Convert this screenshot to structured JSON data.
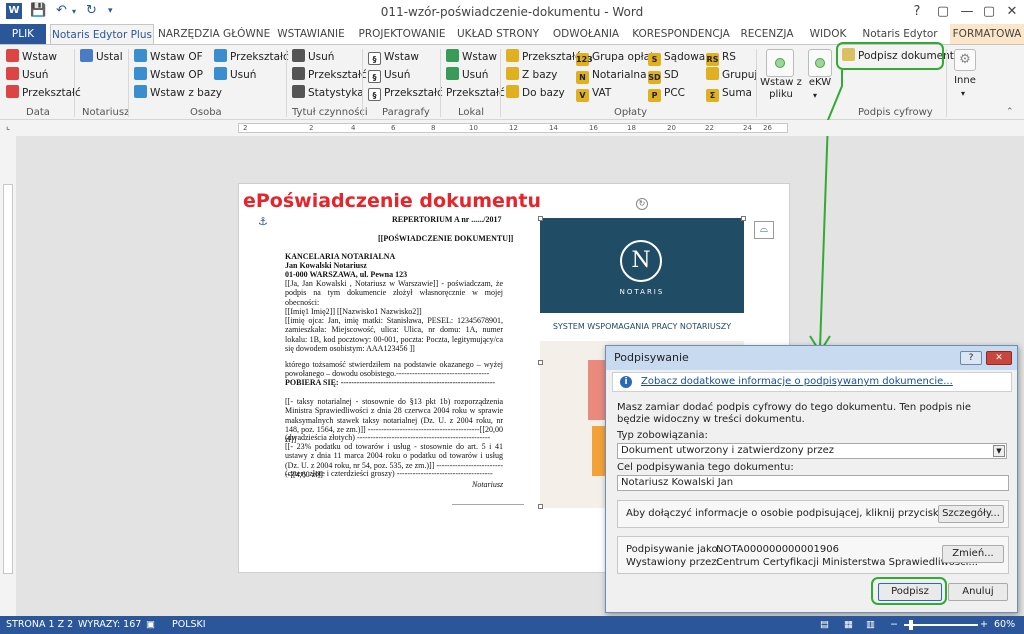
{
  "window": {
    "title": "011-wzór-poświadczenie-dokumentu - Word",
    "controls": [
      "?",
      "▢",
      "—",
      "▢",
      "✕"
    ]
  },
  "tabs": [
    "PLIK",
    "Notaris Edytor Plus",
    "NARZĘDZIA GŁÓWNE",
    "WSTAWIANIE",
    "PROJEKTOWANIE",
    "UKŁAD STRONY",
    "ODWOŁANIA",
    "KORESPONDENCJA",
    "RECENZJA",
    "WIDOK",
    "Notaris Edytor",
    "FORMATOWA"
  ],
  "ribbon": {
    "data": {
      "items": [
        "Wstaw",
        "Usuń",
        "Przekształć"
      ],
      "label": "Data"
    },
    "notariusz": {
      "items": [
        "Ustal"
      ],
      "label": "Notariusz"
    },
    "osoba": {
      "col1": [
        "Wstaw OF",
        "Wstaw OP",
        "Wstaw z bazy"
      ],
      "col2": [
        "Przekształć",
        "Usuń"
      ],
      "label": "Osoba"
    },
    "tytul": {
      "items": [
        "Usuń",
        "Przekształć",
        "Statystyka"
      ],
      "label": "Tytuł czynności"
    },
    "paragrafy": {
      "items": [
        "Wstaw",
        "Usuń",
        "Przekształć"
      ],
      "label": "Paragrafy"
    },
    "lokal": {
      "items": [
        "Wstaw",
        "Usuń",
        "Przekształć"
      ],
      "label": "Lokal"
    },
    "oplaty": {
      "col1": [
        "Przekształć",
        "Z bazy",
        "Do bazy"
      ],
      "col2": [
        "Grupa opłat",
        "Notarialna",
        "VAT"
      ],
      "col3": [
        "Sądowa",
        "SD",
        "PCC"
      ],
      "col4": [
        "RS",
        "Grupuj",
        "Suma"
      ],
      "label": "Opłaty"
    },
    "podpis": {
      "wstaw": "Wstaw z pliku",
      "ekw": "eKW",
      "podpisz": "Podpisz dokument",
      "label": "Podpis cyfrowy"
    },
    "inne": {
      "label": "Inne"
    }
  },
  "ruler": [
    "2",
    "2",
    "4",
    "6",
    "8",
    "10",
    "12",
    "14",
    "16",
    "18",
    "20",
    "22",
    "24",
    "26"
  ],
  "document": {
    "title": "ePoświadczenie dokumentu",
    "repertorium": "REPERTORIUM A nr ....../2017",
    "heading": "[[POŚWIADCZENIE DOKUMENTU]]",
    "kancelaria": "KANCELARIA NOTARIALNA",
    "notary": "Jan Kowalski Notariusz",
    "address": "01-000 WARSZAWA, ul. Pewna 123",
    "para1": "[[Ja, Jan Kowalski , Notariusz w Warszawie]] - poświadczam, że podpis na tym dokumencie złożył własnoręcznie w mojej obecności:",
    "para2": "[[Imię1 Imię2]] [[Nazwisko1 Nazwisko2]]",
    "para3": "[[imię ojca: Jan, imię matki: Stanisława, PESEL: 12345678901, zamieszkała: Miejscowość, ulica: Ulica, nr domu: 1A, numer lokalu: 1B, kod pocztowy: 00-001, poczta: Poczta, legitymujący/ca się dowodem osobistym: AAA123456 ]]",
    "para4": "którego tożsamość stwierdziłem na podstawie okazanego – wyżej powołanego – dowodu osobistego.-----------------------------------",
    "pobiera": "POBIERA SIĘ: ----------------------------------------------------------",
    "para5": "[[- taksy notarialnej - stosownie do §13 pkt 1b) rozporządzenia Ministra Sprawiedliwości z dnia 28 czerwca 2004 roku w sprawie maksymalnych stawek taksy notarialnej (Dz. U. z 2004 roku, nr 148, poz. 1564, ze zm.)]] ------------------------------------------[[20,00 zł]]",
    "para6": "(dwadzieścia złotych) --------------------------------------------------",
    "para7": "[[- 23% podatku od towarów i usług - stosownie do art. 5 i 41 ustawy z dnia 11 marca 2004 roku o podatku od towarów i usług (Dz. U. z 2004 roku, nr 54, poz. 535, ze zm.)]] ---------------------------[[4,60 zł]]",
    "para8": "(cztery złote i czterdzieści groszy) ------------------------------------",
    "signature": "Notariusz",
    "signline": "...................................."
  },
  "image": {
    "logo_letter": "N",
    "brand": "NOTARIS",
    "subtitle": "SYSTEM WSPOMAGANIA PRACY NOTARIUSZY"
  },
  "dialog": {
    "title": "Podpisywanie",
    "info_link": "Zobacz dodatkowe informacje o podpisywanym dokumencie...",
    "question": "Masz zamiar dodać podpis cyfrowy do tego dokumentu. Ten podpis nie będzie widoczny w treści dokumentu.",
    "type_label": "Typ zobowiązania:",
    "type_value": "Dokument utworzony i zatwierdzony przez",
    "purpose_label": "Cel podpisywania tego dokumentu:",
    "purpose_value": "Notariusz Kowalski Jan",
    "details_text": "Aby dołączyć informacje o osobie podpisującej, kliknij przycisk Szczegóły.",
    "details_button": "Szczegóły...",
    "signing_as_label": "Podpisywanie jako:",
    "signing_as_value": "NOTA000000000001906",
    "issued_by_label": "Wystawiony przez:",
    "issued_by_value": "Centrum Certyfikacji Ministerstwa Sprawiedliwości...",
    "change_button": "Zmień...",
    "sign_button": "Podpisz",
    "cancel_button": "Anuluj"
  },
  "status": {
    "page": "STRONA 1 Z 2",
    "words": "WYRAZY: 167",
    "lang": "POLSKI",
    "zoom": "60%"
  },
  "colors": {
    "accent": "#2b579a",
    "title_red": "#e8232a",
    "highlight_green": "#33aa33"
  }
}
